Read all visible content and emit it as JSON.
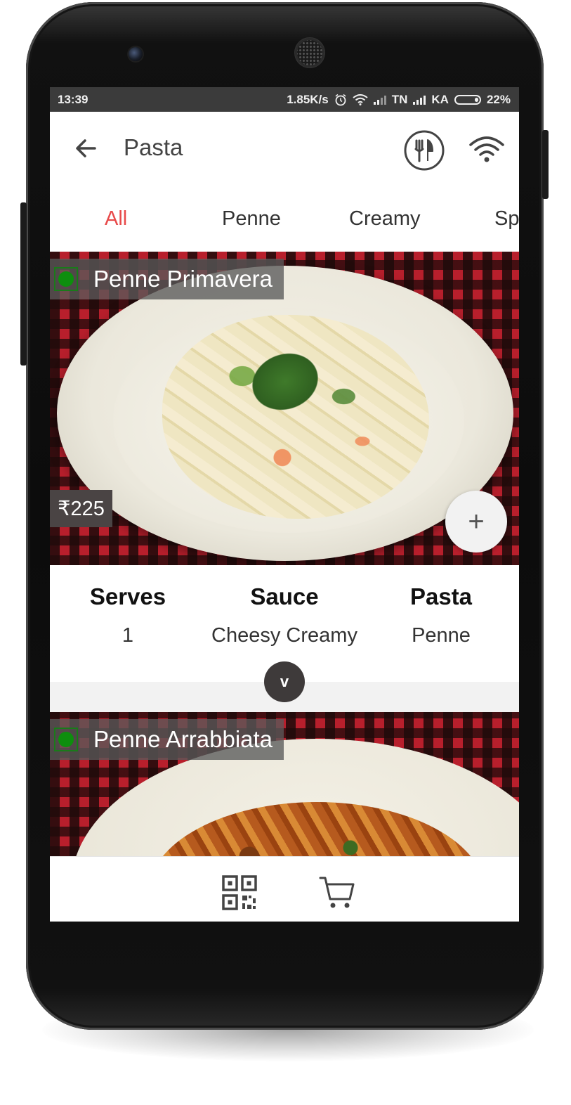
{
  "status_bar": {
    "time": "13:39",
    "speed": "1.85K/s",
    "carrier_1": "TN",
    "carrier_2": "KA",
    "battery": "22%"
  },
  "app_bar": {
    "title": "Pasta",
    "back_icon": "arrow-left-icon",
    "menu_icon": "fork-knife-icon",
    "wifi_icon": "wifi-icon"
  },
  "tabs": [
    {
      "label": "All",
      "active": true
    },
    {
      "label": "Penne",
      "active": false
    },
    {
      "label": "Creamy",
      "active": false
    },
    {
      "label": "Sp",
      "active": false
    }
  ],
  "items": [
    {
      "name": "Penne Primavera",
      "veg": true,
      "price": "₹225",
      "details": [
        {
          "heading": "Serves",
          "value": "1"
        },
        {
          "heading": "Sauce",
          "value": "Cheesy Creamy"
        },
        {
          "heading": "Pasta",
          "value": "Penne"
        }
      ],
      "add_label": "+",
      "expand_label": "v"
    },
    {
      "name": "Penne Arrabbiata",
      "veg": true
    }
  ],
  "bottom_nav": {
    "qr_icon": "qr-code-icon",
    "cart_icon": "cart-icon"
  },
  "colors": {
    "accent": "#e84a4a",
    "veg": "#0e8e0e",
    "status_bar": "#3b3b3b"
  }
}
